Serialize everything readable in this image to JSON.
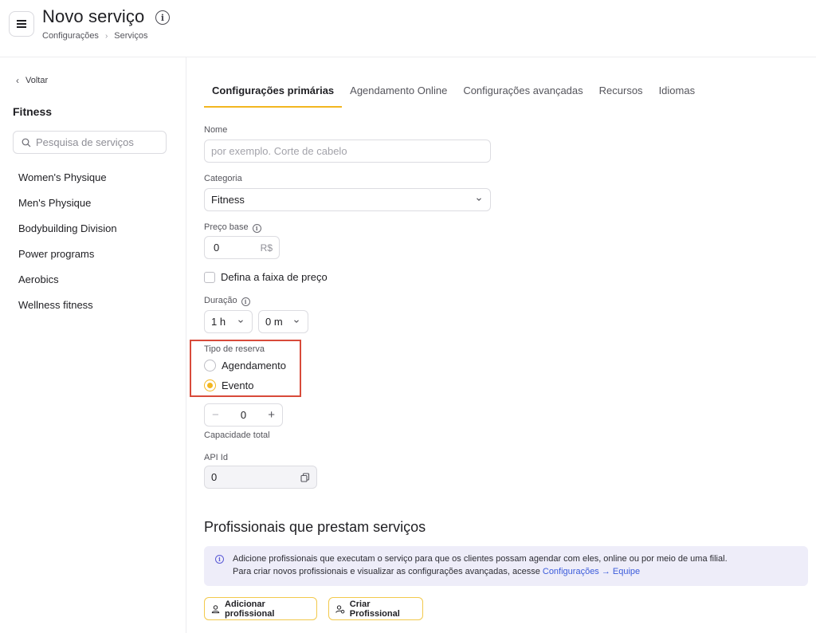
{
  "header": {
    "title": "Novo serviço",
    "breadcrumb": [
      "Configurações",
      "Serviços"
    ]
  },
  "sidebar": {
    "back_label": "Voltar",
    "heading": "Fitness",
    "search_placeholder": "Pesquisa de serviços",
    "items": [
      {
        "label": "Women's Physique"
      },
      {
        "label": "Men's Physique"
      },
      {
        "label": "Bodybuilding Division"
      },
      {
        "label": "Power programs"
      },
      {
        "label": "Aerobics"
      },
      {
        "label": "Wellness fitness"
      }
    ]
  },
  "tabs": [
    {
      "label": "Configurações primárias",
      "active": true
    },
    {
      "label": "Agendamento Online",
      "active": false
    },
    {
      "label": "Configurações avançadas",
      "active": false
    },
    {
      "label": "Recursos",
      "active": false
    },
    {
      "label": "Idiomas",
      "active": false
    }
  ],
  "form": {
    "name_label": "Nome",
    "name_placeholder": "por exemplo. Corte de cabelo",
    "category_label": "Categoria",
    "category_value": "Fitness",
    "price_label": "Preço base",
    "price_value": "0",
    "price_currency": "R$",
    "price_range_label": "Defina a faixa de preço",
    "duration_label": "Duração",
    "duration_hours": "1 h",
    "duration_minutes": "0 m",
    "booking_type_label": "Tipo de reserva",
    "booking_options": [
      {
        "label": "Agendamento",
        "checked": false
      },
      {
        "label": "Evento",
        "checked": true
      }
    ],
    "capacity_value": "0",
    "capacity_label": "Capacidade total",
    "api_label": "API Id",
    "api_value": "0"
  },
  "professionals": {
    "title": "Profissionais que prestam serviços",
    "info_line1": "Adicione profissionais que executam o serviço para que os clientes possam agendar com eles, online ou por meio de uma filial.",
    "info_line2": "Para criar novos profissionais e visualizar as configurações avançadas, acesse",
    "info_link": "Configurações → Equipe",
    "add_button": "Adicionar profissional",
    "create_button": "Criar Profissional"
  },
  "colors": {
    "accent": "#f2b620",
    "highlight": "#d84a3a",
    "link": "#3b5bdb"
  }
}
